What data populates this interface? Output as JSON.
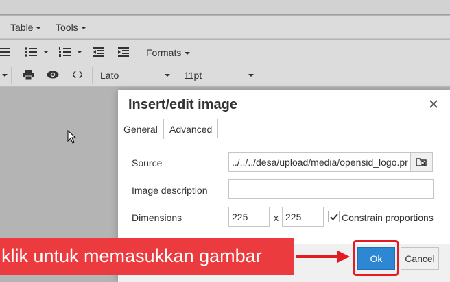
{
  "menubar": {
    "items": [
      {
        "label": "Table"
      },
      {
        "label": "Tools"
      }
    ]
  },
  "toolbar": {
    "formats_label": "Formats",
    "font_family": "Lato",
    "font_size": "11pt"
  },
  "dialog": {
    "title": "Insert/edit image",
    "tabs": [
      {
        "label": "General",
        "active": true
      },
      {
        "label": "Advanced",
        "active": false
      }
    ],
    "source_label": "Source",
    "source_value": "../../../desa/upload/media/opensid_logo.pr",
    "description_label": "Image description",
    "description_value": "",
    "dimensions_label": "Dimensions",
    "width_value": "225",
    "height_value": "225",
    "dimension_separator": "x",
    "constrain_label": "Constrain proportions",
    "constrain_checked": true,
    "ok_label": "Ok",
    "cancel_label": "Cancel"
  },
  "annotation": {
    "text": "klik untuk memasukkan gambar"
  },
  "colors": {
    "ok_button": "#2d87d3",
    "highlight": "#e31b23",
    "annotation_bg": "#ec3b3f"
  }
}
